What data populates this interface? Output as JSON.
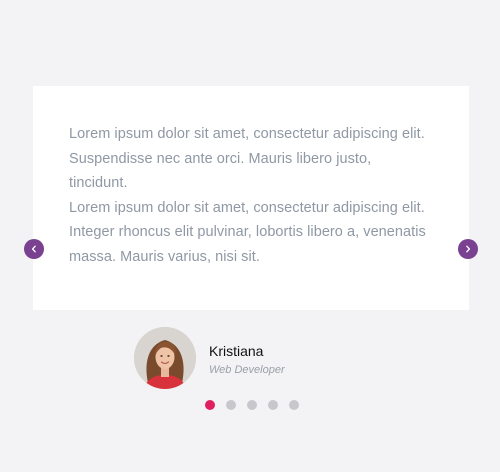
{
  "testimonial": {
    "lines": [
      "Lorem ipsum dolor sit amet, consectetur adipiscing elit.",
      "Suspendisse nec ante orci. Mauris libero justo,",
      "tincidunt.",
      "Lorem ipsum dolor sit amet, consectetur adipiscing elit.",
      "Integer rhoncus elit pulvinar, lobortis libero a, venenatis",
      "massa. Mauris varius, nisi sit."
    ]
  },
  "author": {
    "name": "Kristiana",
    "role": "Web Developer"
  },
  "navigation": {
    "prev_icon": "chevron-left-icon",
    "next_icon": "chevron-right-icon",
    "dot_count": 5,
    "active_dot": 1
  },
  "colors": {
    "accent": "#7a4190",
    "active_dot": "#e01f5f",
    "inactive_dot": "#c8c8cc",
    "quote_text": "#8f98a4",
    "background": "#f3f3f5",
    "card": "#ffffff"
  }
}
